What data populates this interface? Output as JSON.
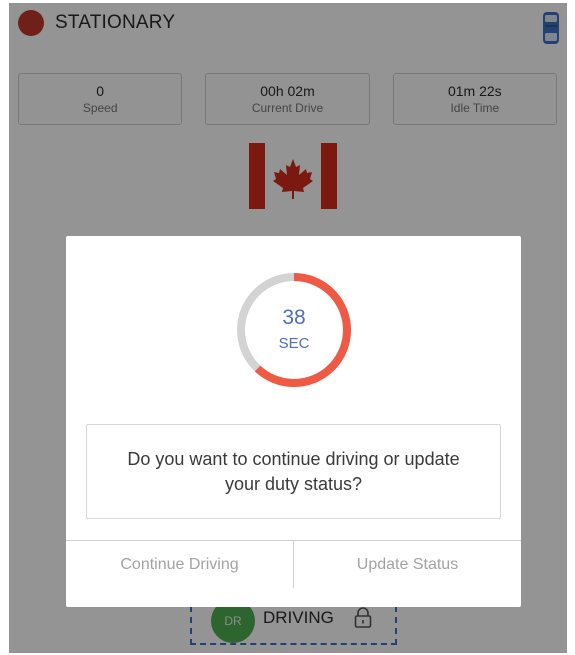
{
  "header": {
    "status_title": "STATIONARY",
    "status_color": "#c0392b",
    "vehicle_icon": "truck-top-icon"
  },
  "stats": [
    {
      "value": "0",
      "label": "Speed"
    },
    {
      "value": "00h 02m",
      "label": "Current Drive"
    },
    {
      "value": "01m 22s",
      "label": "Idle Time"
    }
  ],
  "flag": {
    "icon": "canada-flag-icon",
    "red": "#d52b1e"
  },
  "dialog": {
    "countdown": "38",
    "countdown_unit": "SEC",
    "countdown_progress": 0.62,
    "ring_color": "#ef5a45",
    "ring_track_color": "#d3d3d3",
    "question": "Do you want to continue driving or update your duty status?",
    "continue_label": "Continue Driving",
    "update_label": "Update Status"
  },
  "duty": {
    "badge": "DR",
    "badge_color": "#4caf50",
    "label": "DRIVING",
    "lock_icon": "lock-icon"
  }
}
